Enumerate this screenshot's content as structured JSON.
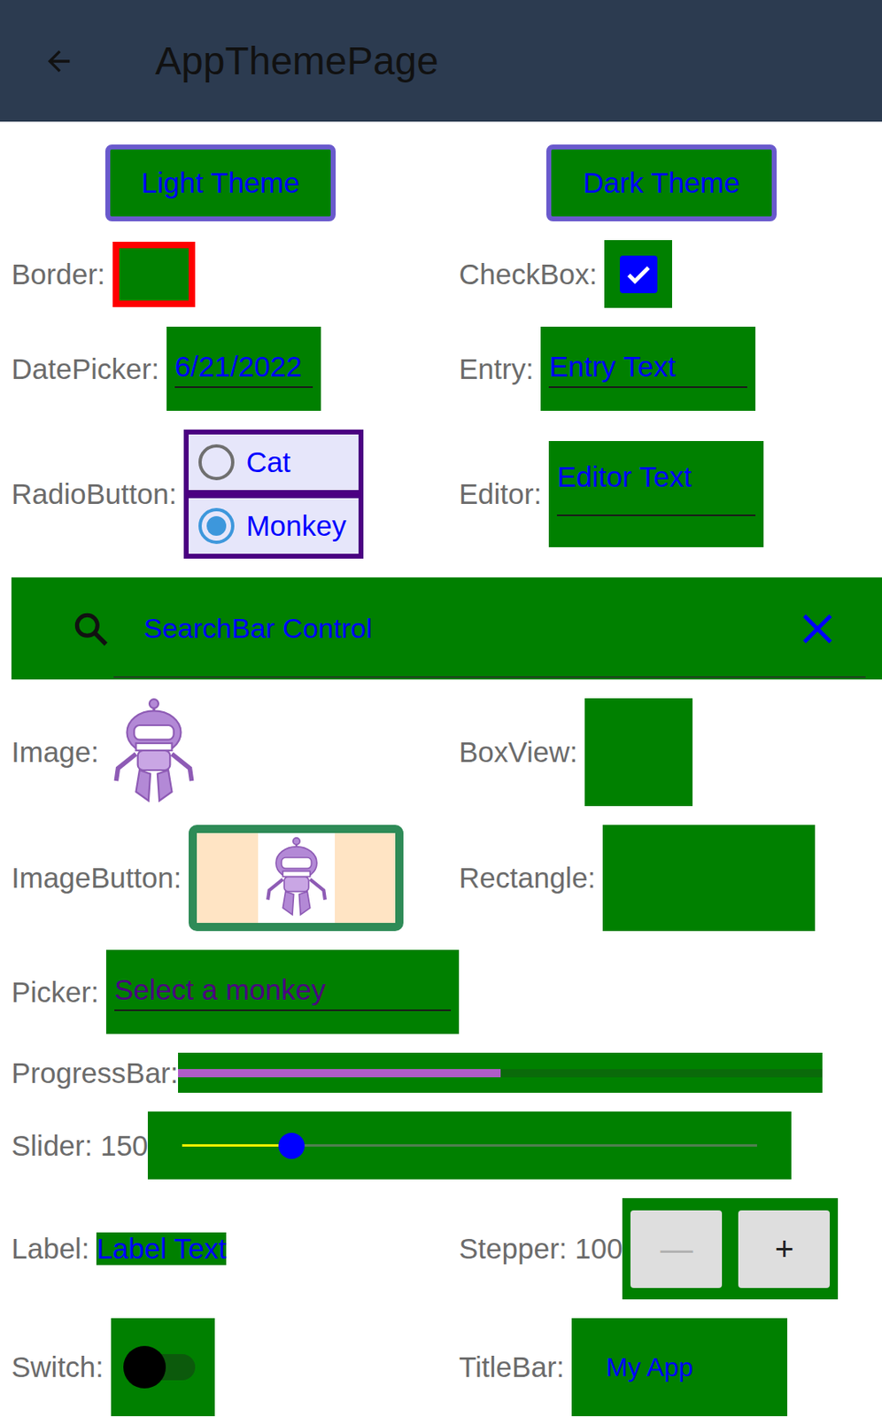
{
  "header": {
    "title": "AppThemePage"
  },
  "theme_buttons": [
    {
      "label": "Light Theme"
    },
    {
      "label": "Dark Theme"
    }
  ],
  "border": {
    "label": "Border:"
  },
  "checkbox": {
    "label": "CheckBox:",
    "checked": true
  },
  "date_picker": {
    "label": "DatePicker:",
    "value": "6/21/2022"
  },
  "entry": {
    "label": "Entry:",
    "value": "Entry Text"
  },
  "radio_button": {
    "label": "RadioButton:",
    "options": [
      {
        "label": "Cat",
        "selected": false
      },
      {
        "label": "Monkey",
        "selected": true
      }
    ]
  },
  "editor": {
    "label": "Editor:",
    "value": "Editor Text"
  },
  "search_bar": {
    "value": "SearchBar Control"
  },
  "image": {
    "label": "Image:"
  },
  "box_view": {
    "label": "BoxView:"
  },
  "image_button": {
    "label": "ImageButton:"
  },
  "rectangle": {
    "label": "Rectangle:"
  },
  "picker": {
    "label": "Picker:",
    "placeholder": "Select a monkey"
  },
  "progress_bar": {
    "label": "ProgressBar:",
    "level": 0.5
  },
  "slider": {
    "label": "Slider: 150",
    "level": 0.19
  },
  "label": {
    "label": "Label:",
    "text": "Label Text"
  },
  "stepper": {
    "label": "Stepper: 100",
    "minus": {
      "text": "—",
      "disabled": true
    },
    "plus": {
      "text": "+",
      "disabled": false
    }
  },
  "switch": {
    "label": "Switch:",
    "on": false
  },
  "title_bar": {
    "label": "TitleBar:",
    "title": "My App"
  }
}
